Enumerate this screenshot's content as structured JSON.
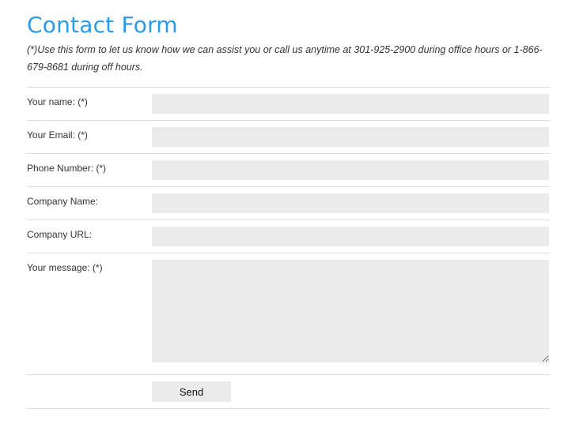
{
  "header": {
    "title": "Contact Form",
    "intro": "(*)Use this form to let us know how we can assist you or call us anytime at 301-925-2900 during office hours or 1-866-679-8681 during off hours."
  },
  "form": {
    "fields": [
      {
        "label": "Your name: (*)",
        "value": ""
      },
      {
        "label": "Your Email: (*)",
        "value": ""
      },
      {
        "label": "Phone Number: (*)",
        "value": ""
      },
      {
        "label": "Company Name:",
        "value": ""
      },
      {
        "label": "Company URL:",
        "value": ""
      }
    ],
    "message": {
      "label": "Your message: (*)",
      "value": ""
    },
    "send_label": "Send"
  }
}
